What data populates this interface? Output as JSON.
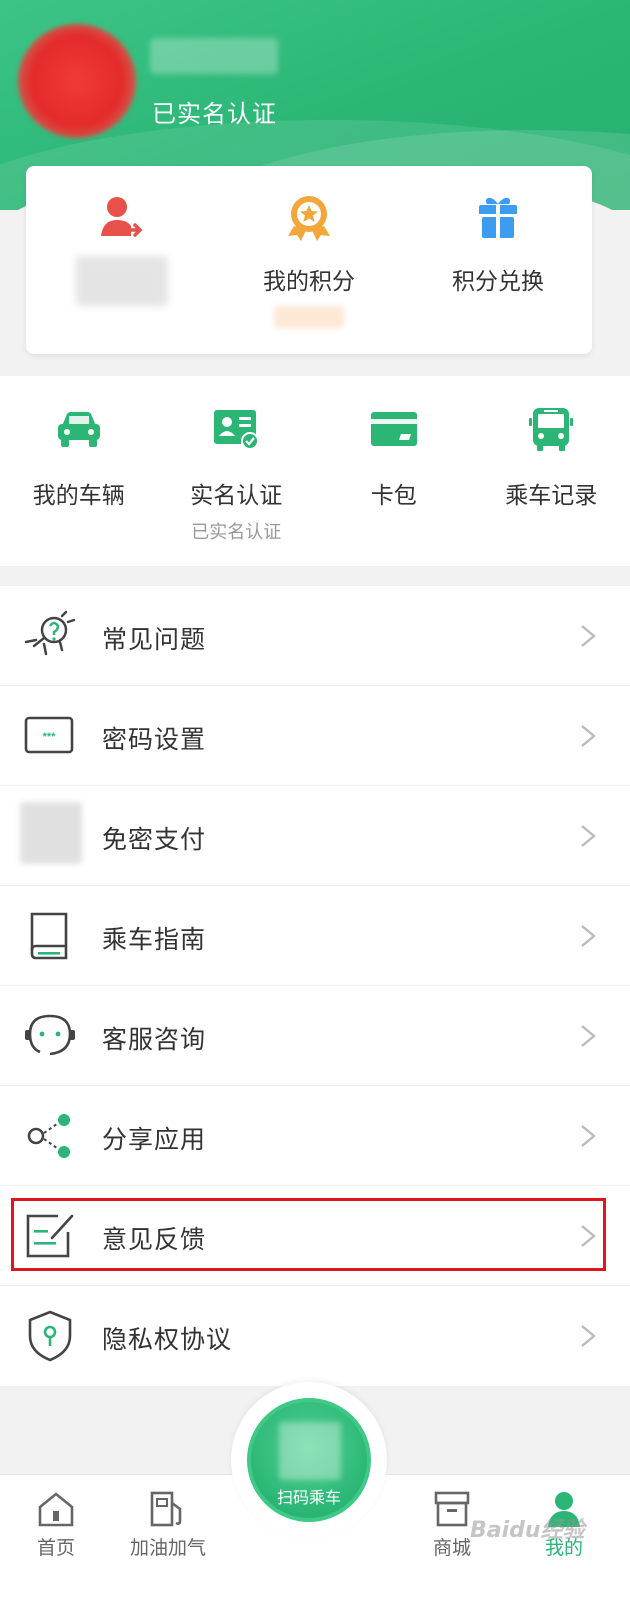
{
  "profile": {
    "verified_status": "已实名认证"
  },
  "points_card": {
    "items": [
      {
        "label": "",
        "icon": "user-transfer-icon"
      },
      {
        "label": "我的积分",
        "icon": "medal-icon"
      },
      {
        "label": "积分兑换",
        "icon": "gift-icon"
      }
    ]
  },
  "quick_grid": {
    "items": [
      {
        "label": "我的车辆",
        "sublabel": "",
        "icon": "car-icon"
      },
      {
        "label": "实名认证",
        "sublabel": "已实名认证",
        "icon": "id-card-icon"
      },
      {
        "label": "卡包",
        "sublabel": "",
        "icon": "card-wallet-icon"
      },
      {
        "label": "乘车记录",
        "sublabel": "",
        "icon": "bus-icon"
      }
    ]
  },
  "menu": {
    "items": [
      {
        "label": "常见问题",
        "icon": "faq-icon"
      },
      {
        "label": "密码设置",
        "icon": "password-icon"
      },
      {
        "label": "免密支付",
        "icon": "payment-icon"
      },
      {
        "label": "乘车指南",
        "icon": "guide-book-icon"
      },
      {
        "label": "客服咨询",
        "icon": "customer-service-icon"
      },
      {
        "label": "分享应用",
        "icon": "share-icon"
      },
      {
        "label": "意见反馈",
        "icon": "feedback-icon"
      },
      {
        "label": "隐私权协议",
        "icon": "privacy-shield-icon"
      }
    ]
  },
  "tabbar": {
    "items": [
      {
        "label": "首页",
        "icon": "home-icon"
      },
      {
        "label": "加油加气",
        "icon": "fuel-icon"
      },
      {
        "label": "商城",
        "icon": "store-icon"
      },
      {
        "label": "我的",
        "icon": "profile-icon",
        "active": true
      }
    ],
    "scan_label": "扫码乘车"
  },
  "colors": {
    "brand_green": "#2bb676",
    "highlight_red": "#e2141b"
  },
  "watermark": "Baidu经验"
}
